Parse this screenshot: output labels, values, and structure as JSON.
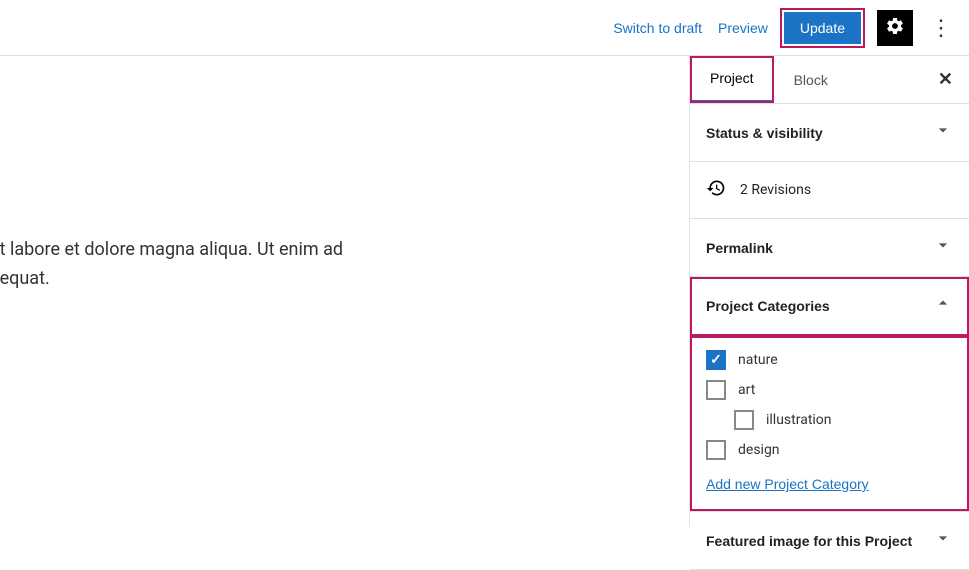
{
  "topbar": {
    "switch_draft": "Switch to draft",
    "preview": "Preview",
    "update": "Update"
  },
  "content": {
    "line1": "mpor incididunt ut labore et dolore magna aliqua. Ut enim ad",
    "line2": "a commodo consequat."
  },
  "sidebar": {
    "tabs": {
      "project": "Project",
      "block": "Block"
    },
    "panels": {
      "status": {
        "title": "Status & visibility"
      },
      "revisions": {
        "text": "2 Revisions"
      },
      "permalink": {
        "title": "Permalink"
      },
      "categories": {
        "title": "Project Categories",
        "items": [
          {
            "label": "nature",
            "checked": true,
            "indent": false
          },
          {
            "label": "art",
            "checked": false,
            "indent": false
          },
          {
            "label": "illustration",
            "checked": false,
            "indent": true
          },
          {
            "label": "design",
            "checked": false,
            "indent": false
          }
        ],
        "add_link": "Add new Project Category"
      },
      "featured": {
        "title": "Featured image for this Project"
      }
    }
  },
  "icons": {
    "gear": "gear-icon",
    "options": "more-vertical-icon",
    "close": "close-icon",
    "history": "history-icon",
    "chevron_down": "chevron-down-icon",
    "chevron_up": "chevron-up-icon"
  }
}
